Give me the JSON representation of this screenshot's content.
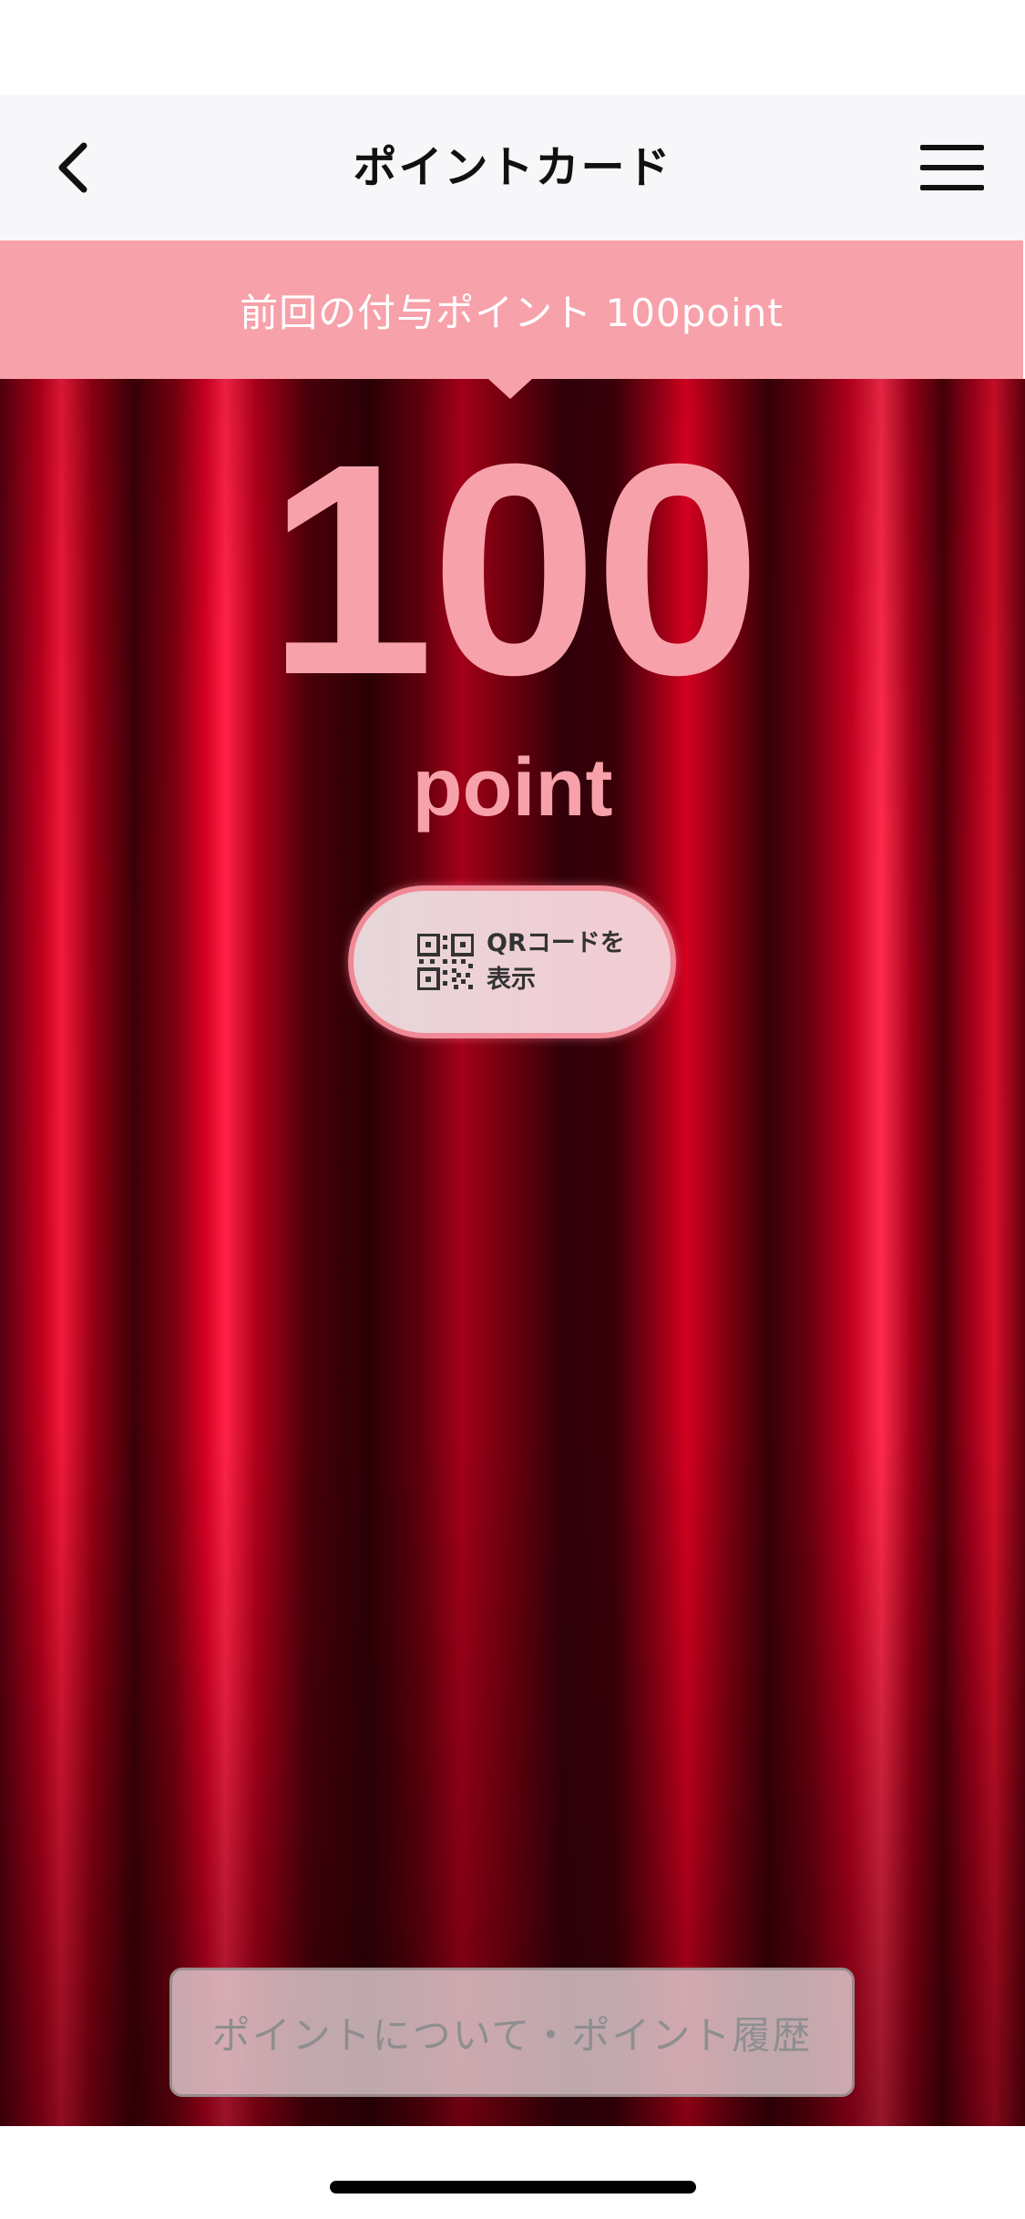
{
  "nav": {
    "title": "ポイントカード",
    "back_icon": "chevron-left-icon",
    "menu_icon": "hamburger-menu-icon"
  },
  "notice": {
    "text": "前回の付与ポイント 100point"
  },
  "points": {
    "value": "100",
    "unit": "point"
  },
  "qr_button": {
    "label": "QRコードを表示",
    "icon": "qr-code-icon"
  },
  "history_button": {
    "label": "ポイントについて・ポイント履歴"
  },
  "colors": {
    "accent_pink": "#f7a1aa",
    "curtain_red": "#c8001e",
    "nav_background": "#f7f7f9"
  }
}
